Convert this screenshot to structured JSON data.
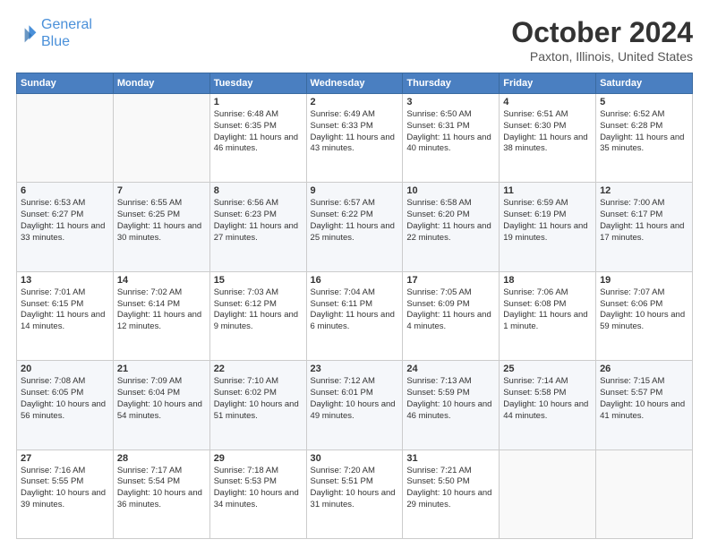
{
  "header": {
    "logo_line1": "General",
    "logo_line2": "Blue",
    "title": "October 2024",
    "subtitle": "Paxton, Illinois, United States"
  },
  "days_of_week": [
    "Sunday",
    "Monday",
    "Tuesday",
    "Wednesday",
    "Thursday",
    "Friday",
    "Saturday"
  ],
  "weeks": [
    [
      {
        "day": "",
        "sunrise": "",
        "sunset": "",
        "daylight": ""
      },
      {
        "day": "",
        "sunrise": "",
        "sunset": "",
        "daylight": ""
      },
      {
        "day": "1",
        "sunrise": "Sunrise: 6:48 AM",
        "sunset": "Sunset: 6:35 PM",
        "daylight": "Daylight: 11 hours and 46 minutes."
      },
      {
        "day": "2",
        "sunrise": "Sunrise: 6:49 AM",
        "sunset": "Sunset: 6:33 PM",
        "daylight": "Daylight: 11 hours and 43 minutes."
      },
      {
        "day": "3",
        "sunrise": "Sunrise: 6:50 AM",
        "sunset": "Sunset: 6:31 PM",
        "daylight": "Daylight: 11 hours and 40 minutes."
      },
      {
        "day": "4",
        "sunrise": "Sunrise: 6:51 AM",
        "sunset": "Sunset: 6:30 PM",
        "daylight": "Daylight: 11 hours and 38 minutes."
      },
      {
        "day": "5",
        "sunrise": "Sunrise: 6:52 AM",
        "sunset": "Sunset: 6:28 PM",
        "daylight": "Daylight: 11 hours and 35 minutes."
      }
    ],
    [
      {
        "day": "6",
        "sunrise": "Sunrise: 6:53 AM",
        "sunset": "Sunset: 6:27 PM",
        "daylight": "Daylight: 11 hours and 33 minutes."
      },
      {
        "day": "7",
        "sunrise": "Sunrise: 6:55 AM",
        "sunset": "Sunset: 6:25 PM",
        "daylight": "Daylight: 11 hours and 30 minutes."
      },
      {
        "day": "8",
        "sunrise": "Sunrise: 6:56 AM",
        "sunset": "Sunset: 6:23 PM",
        "daylight": "Daylight: 11 hours and 27 minutes."
      },
      {
        "day": "9",
        "sunrise": "Sunrise: 6:57 AM",
        "sunset": "Sunset: 6:22 PM",
        "daylight": "Daylight: 11 hours and 25 minutes."
      },
      {
        "day": "10",
        "sunrise": "Sunrise: 6:58 AM",
        "sunset": "Sunset: 6:20 PM",
        "daylight": "Daylight: 11 hours and 22 minutes."
      },
      {
        "day": "11",
        "sunrise": "Sunrise: 6:59 AM",
        "sunset": "Sunset: 6:19 PM",
        "daylight": "Daylight: 11 hours and 19 minutes."
      },
      {
        "day": "12",
        "sunrise": "Sunrise: 7:00 AM",
        "sunset": "Sunset: 6:17 PM",
        "daylight": "Daylight: 11 hours and 17 minutes."
      }
    ],
    [
      {
        "day": "13",
        "sunrise": "Sunrise: 7:01 AM",
        "sunset": "Sunset: 6:15 PM",
        "daylight": "Daylight: 11 hours and 14 minutes."
      },
      {
        "day": "14",
        "sunrise": "Sunrise: 7:02 AM",
        "sunset": "Sunset: 6:14 PM",
        "daylight": "Daylight: 11 hours and 12 minutes."
      },
      {
        "day": "15",
        "sunrise": "Sunrise: 7:03 AM",
        "sunset": "Sunset: 6:12 PM",
        "daylight": "Daylight: 11 hours and 9 minutes."
      },
      {
        "day": "16",
        "sunrise": "Sunrise: 7:04 AM",
        "sunset": "Sunset: 6:11 PM",
        "daylight": "Daylight: 11 hours and 6 minutes."
      },
      {
        "day": "17",
        "sunrise": "Sunrise: 7:05 AM",
        "sunset": "Sunset: 6:09 PM",
        "daylight": "Daylight: 11 hours and 4 minutes."
      },
      {
        "day": "18",
        "sunrise": "Sunrise: 7:06 AM",
        "sunset": "Sunset: 6:08 PM",
        "daylight": "Daylight: 11 hours and 1 minute."
      },
      {
        "day": "19",
        "sunrise": "Sunrise: 7:07 AM",
        "sunset": "Sunset: 6:06 PM",
        "daylight": "Daylight: 10 hours and 59 minutes."
      }
    ],
    [
      {
        "day": "20",
        "sunrise": "Sunrise: 7:08 AM",
        "sunset": "Sunset: 6:05 PM",
        "daylight": "Daylight: 10 hours and 56 minutes."
      },
      {
        "day": "21",
        "sunrise": "Sunrise: 7:09 AM",
        "sunset": "Sunset: 6:04 PM",
        "daylight": "Daylight: 10 hours and 54 minutes."
      },
      {
        "day": "22",
        "sunrise": "Sunrise: 7:10 AM",
        "sunset": "Sunset: 6:02 PM",
        "daylight": "Daylight: 10 hours and 51 minutes."
      },
      {
        "day": "23",
        "sunrise": "Sunrise: 7:12 AM",
        "sunset": "Sunset: 6:01 PM",
        "daylight": "Daylight: 10 hours and 49 minutes."
      },
      {
        "day": "24",
        "sunrise": "Sunrise: 7:13 AM",
        "sunset": "Sunset: 5:59 PM",
        "daylight": "Daylight: 10 hours and 46 minutes."
      },
      {
        "day": "25",
        "sunrise": "Sunrise: 7:14 AM",
        "sunset": "Sunset: 5:58 PM",
        "daylight": "Daylight: 10 hours and 44 minutes."
      },
      {
        "day": "26",
        "sunrise": "Sunrise: 7:15 AM",
        "sunset": "Sunset: 5:57 PM",
        "daylight": "Daylight: 10 hours and 41 minutes."
      }
    ],
    [
      {
        "day": "27",
        "sunrise": "Sunrise: 7:16 AM",
        "sunset": "Sunset: 5:55 PM",
        "daylight": "Daylight: 10 hours and 39 minutes."
      },
      {
        "day": "28",
        "sunrise": "Sunrise: 7:17 AM",
        "sunset": "Sunset: 5:54 PM",
        "daylight": "Daylight: 10 hours and 36 minutes."
      },
      {
        "day": "29",
        "sunrise": "Sunrise: 7:18 AM",
        "sunset": "Sunset: 5:53 PM",
        "daylight": "Daylight: 10 hours and 34 minutes."
      },
      {
        "day": "30",
        "sunrise": "Sunrise: 7:20 AM",
        "sunset": "Sunset: 5:51 PM",
        "daylight": "Daylight: 10 hours and 31 minutes."
      },
      {
        "day": "31",
        "sunrise": "Sunrise: 7:21 AM",
        "sunset": "Sunset: 5:50 PM",
        "daylight": "Daylight: 10 hours and 29 minutes."
      },
      {
        "day": "",
        "sunrise": "",
        "sunset": "",
        "daylight": ""
      },
      {
        "day": "",
        "sunrise": "",
        "sunset": "",
        "daylight": ""
      }
    ]
  ]
}
